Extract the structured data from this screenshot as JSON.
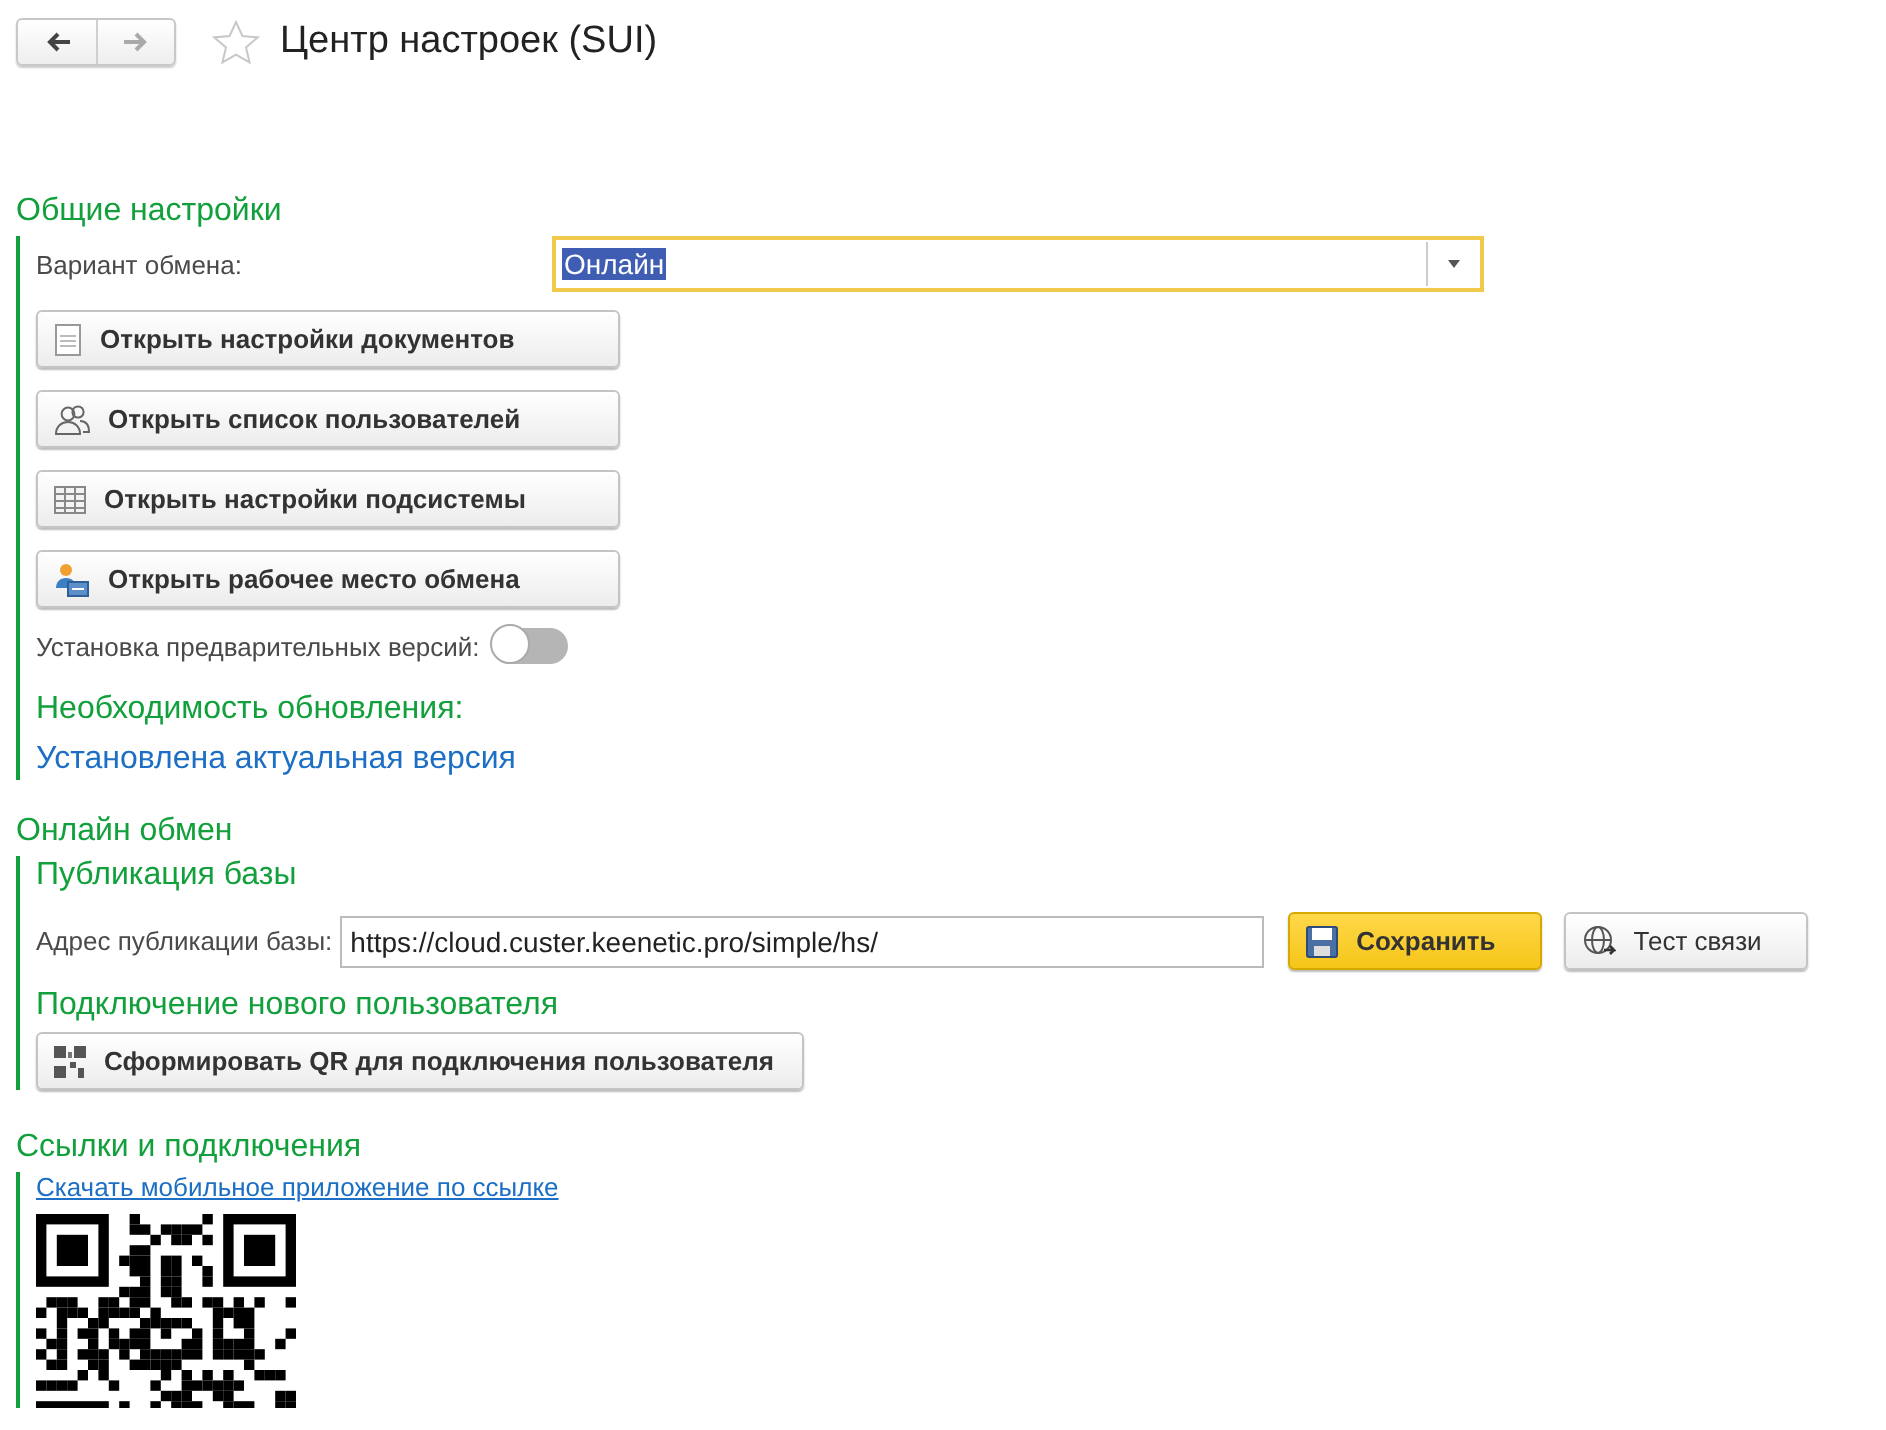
{
  "header": {
    "nav": [
      {
        "kind": "back",
        "disabled": false
      },
      {
        "kind": "forward",
        "disabled": true
      }
    ],
    "favorite": false,
    "title": "Центр настроек (SUI)"
  },
  "general": {
    "title": "Общие настройки",
    "exchange_variant": {
      "label": "Вариант обмена:",
      "value": "Онлайн"
    },
    "buttons": [
      {
        "kind": "document",
        "label": "Открыть настройки документов"
      },
      {
        "kind": "users",
        "label": "Открыть список пользователей"
      },
      {
        "kind": "table",
        "label": "Открыть настройки подсистемы"
      },
      {
        "kind": "workplace",
        "label": "Открыть рабочее место обмена"
      }
    ],
    "prerelease": {
      "label": "Установка предварительных версий:",
      "on": false
    },
    "update": {
      "title": "Необходимость обновления:",
      "status": "Установлена актуальная версия"
    }
  },
  "online": {
    "title": "Онлайн обмен",
    "publication": {
      "title": "Публикация базы",
      "address_label": "Адрес публикации базы:",
      "address_value": "https://cloud.custer.keenetic.pro/simple/hs/",
      "save_button": "Сохранить",
      "test_button": "Тест связи"
    },
    "new_user": {
      "title": "Подключение нового пользователя",
      "button": {
        "kind": "qr",
        "label": "Сформировать QR для подключения пользователя"
      }
    }
  },
  "links": {
    "title": "Ссылки и подключения",
    "link": "Скачать мобильное приложение по ссылке"
  }
}
